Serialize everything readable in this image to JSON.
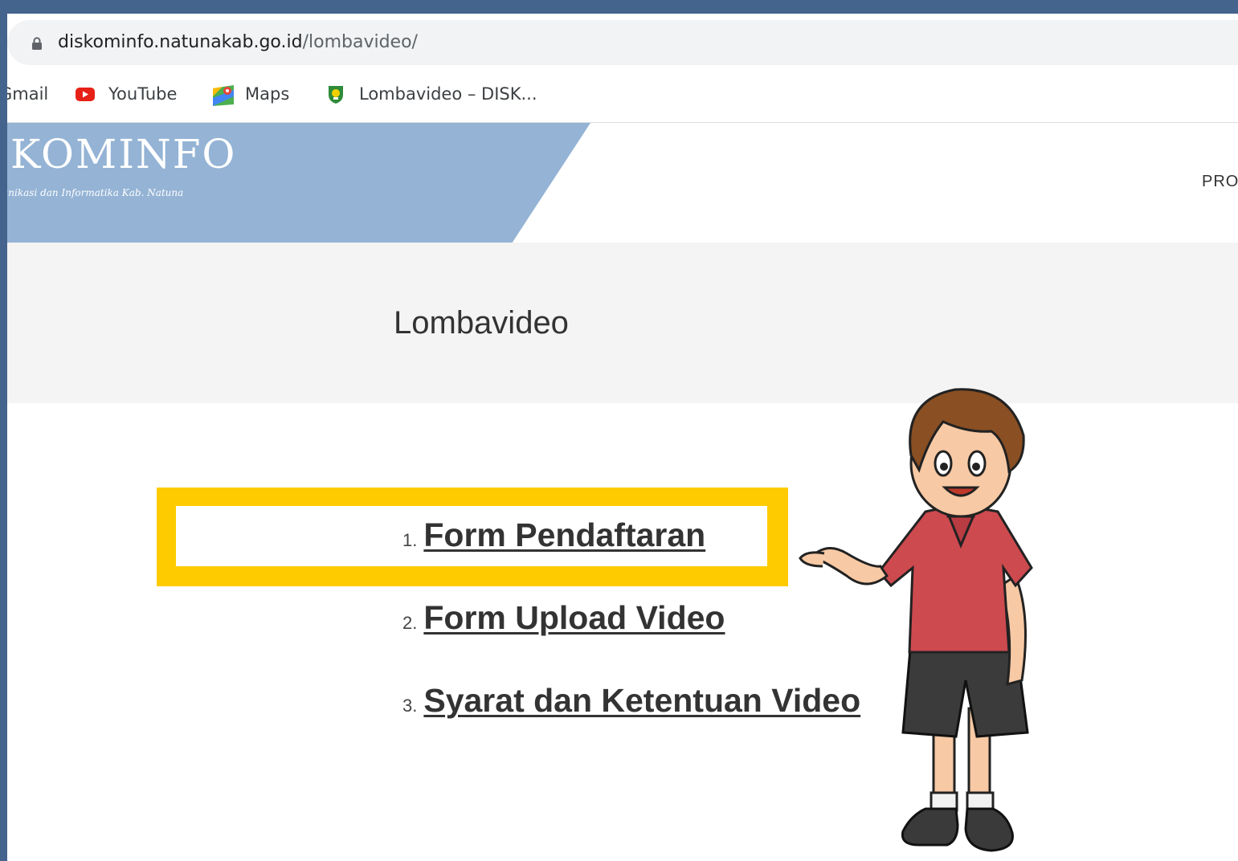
{
  "browser": {
    "url_domain": "diskominfo.natunakab.go.id",
    "url_path": "/lombavideo/",
    "lock_icon": "lock-icon"
  },
  "bookmarks": [
    {
      "label": "Gmail",
      "icon": "gmail-icon"
    },
    {
      "label": "YouTube",
      "icon": "youtube-icon"
    },
    {
      "label": "Maps",
      "icon": "maps-icon"
    },
    {
      "label": "Lombavideo – DISK...",
      "icon": "natuna-logo-icon"
    }
  ],
  "site": {
    "brand_title": "KOMINFO",
    "brand_subtitle": "Dinas Komunikasi dan Informatika Kab. Natuna",
    "nav_partial": "PRO",
    "colors": {
      "brand_panel": "#94b3d5",
      "highlight": "#fdcb00",
      "frame": "#44648d"
    }
  },
  "page": {
    "title": "Lombavideo",
    "items": [
      {
        "num": "1.",
        "label": "Form Pendaftaran"
      },
      {
        "num": "2.",
        "label": "Form Upload Video"
      },
      {
        "num": "3.",
        "label": "Syarat dan Ketentuan Video"
      }
    ]
  }
}
